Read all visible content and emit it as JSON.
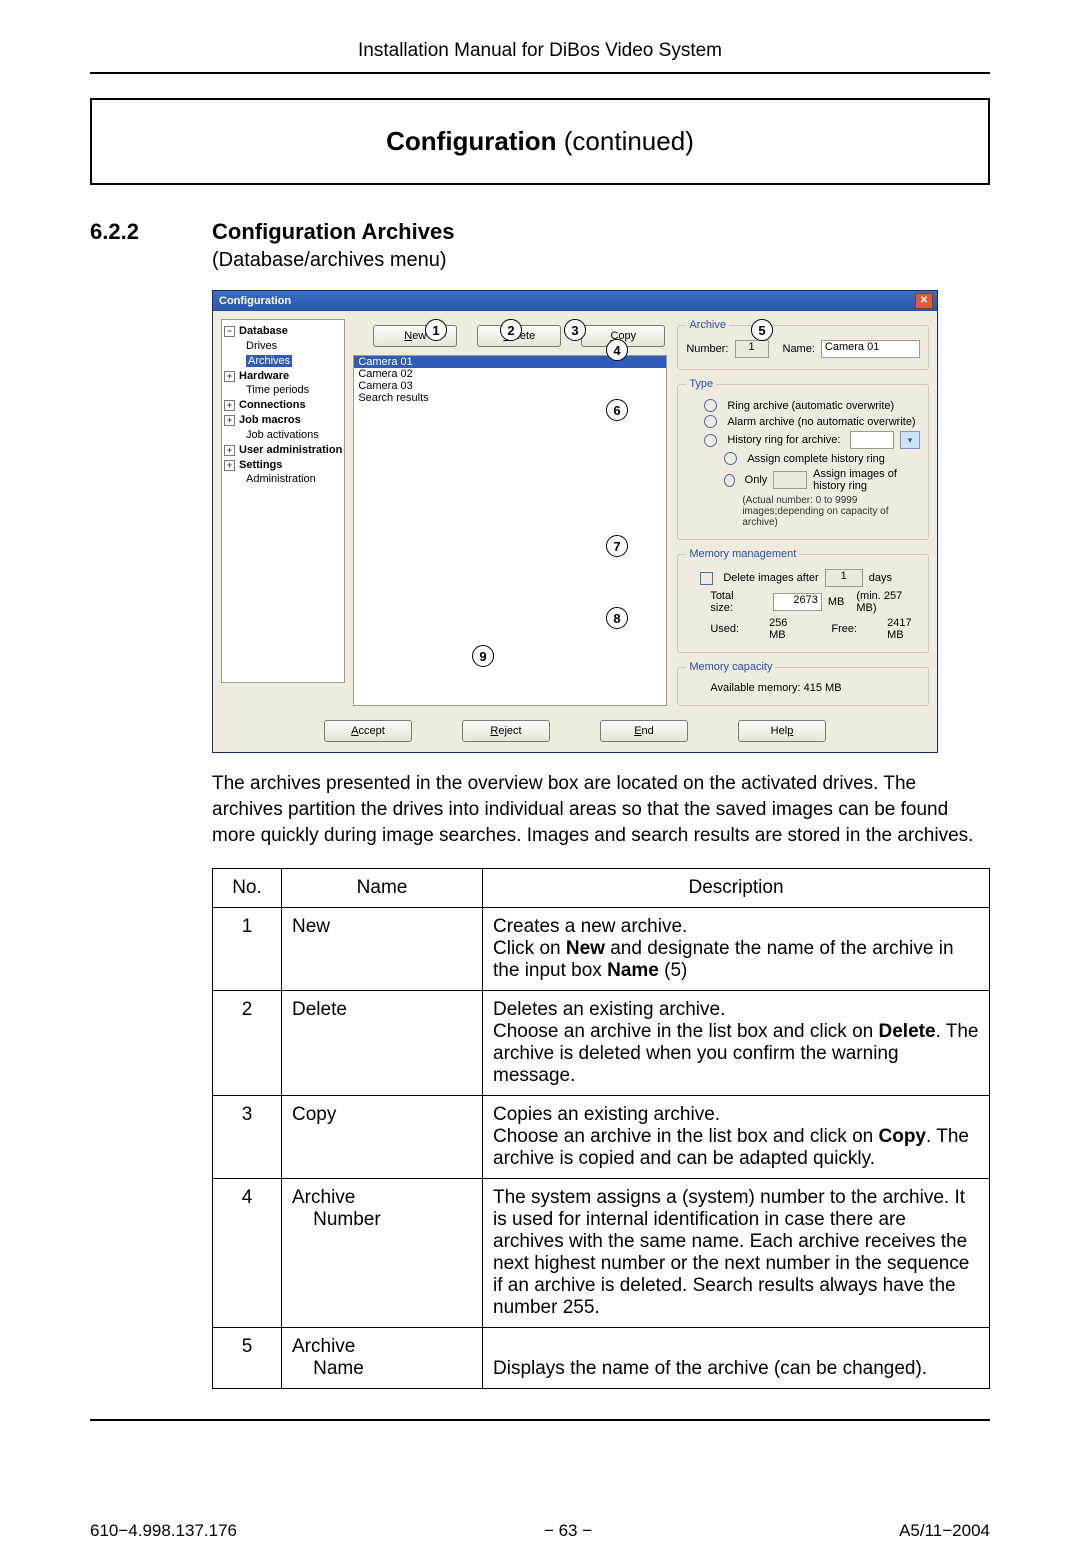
{
  "running_head": "Installation Manual for DiBos Video System",
  "chapter": {
    "title_bold": "Configuration",
    "title_cont": "  (continued)"
  },
  "section": {
    "num": "6.2.2",
    "title": "Configuration Archives",
    "sub": "(Database/archives  menu)"
  },
  "dialog": {
    "title": "Configuration",
    "tree": [
      {
        "t": "Database",
        "lvl": 1,
        "exp": "-"
      },
      {
        "t": "Drives",
        "lvl": 2,
        "sel": false
      },
      {
        "t": "Archives",
        "lvl": 2,
        "sel": true
      },
      {
        "t": "Hardware",
        "lvl": 1,
        "exp": "+"
      },
      {
        "t": "Time periods",
        "lvl": 2,
        "plain": true
      },
      {
        "t": "Connections",
        "lvl": 1,
        "exp": "+"
      },
      {
        "t": "Job macros",
        "lvl": 1,
        "exp": "+"
      },
      {
        "t": "Job activations",
        "lvl": 2,
        "plain": true
      },
      {
        "t": "User administration",
        "lvl": 1,
        "exp": "+"
      },
      {
        "t": "Settings",
        "lvl": 1,
        "exp": "+"
      },
      {
        "t": "Administration",
        "lvl": 2,
        "plain": true
      }
    ],
    "buttons": {
      "new": "New",
      "delete": "Delete",
      "copy": "Copy"
    },
    "list": [
      "Camera 01",
      "Camera 02",
      "Camera 03",
      "Search results"
    ],
    "archive": {
      "legend": "Archive",
      "number_label": "Number:",
      "number_value": "1",
      "name_label": "Name:",
      "name_value": "Camera 01"
    },
    "type": {
      "legend": "Type",
      "ring": "Ring archive    (automatic overwrite)",
      "alarm": "Alarm archive (no automatic overwrite)",
      "history": "History ring for archive:",
      "assign": "Assign complete history ring",
      "only": "Only",
      "only2": "Assign images of history ring",
      "actual": "(Actual number: 0 to 9999 images;depending on capacity of archive)"
    },
    "mem": {
      "legend": "Memory management",
      "del": "Delete images after",
      "days": "days",
      "del_val": "1",
      "total": "Total size:",
      "total_val": "2673",
      "mb": "MB",
      "min": "(min. 257  MB)",
      "used": "Used:",
      "used_val": "256  MB",
      "free": "Free:",
      "free_val": "2417 MB"
    },
    "cap": {
      "legend": "Memory capacity",
      "avail": "Available memory:  415 MB"
    },
    "footer": {
      "accept": "Accept",
      "reject": "Reject",
      "end": "End",
      "help": "Help"
    }
  },
  "callouts": [
    "1",
    "2",
    "3",
    "4",
    "5",
    "6",
    "7",
    "8",
    "9"
  ],
  "body_para": "The archives presented in the overview box are located on the activated drives. The archives partition the drives into individual areas so that the saved images can be found more quickly during image searches. Images and search results are stored in the archives.",
  "table": {
    "head": {
      "no": "No.",
      "name": "Name",
      "desc": "Description"
    },
    "rows": [
      {
        "no": "1",
        "name": "New",
        "desc": "Creates a new archive.\nClick on <b>New</b> and designate the name of the archive in the input box <b>Name</b> (5)"
      },
      {
        "no": "2",
        "name": "Delete",
        "desc": "Deletes an existing archive.\nChoose an archive in the list box and click on <b>Delete</b>. The archive is deleted when you confirm the warning message."
      },
      {
        "no": "3",
        "name": "Copy",
        "desc": "Copies an existing archive.\nChoose an archive in the list box and click on <b>Copy</b>. The archive is copied and can be adapted quickly."
      },
      {
        "no": "4",
        "name": "Archive\n    Number",
        "desc": "The system assigns a (system) number to the archive. It is used for internal identification in case there are archives with the same name. Each archive receives the next highest number or the next number in the sequence if an archive is deleted. Search results always have the number 255."
      },
      {
        "no": "5",
        "name": "Archive\n    Name",
        "desc": "\nDisplays the name of the archive (can be changed)."
      }
    ]
  },
  "footer": {
    "left": "610−4.998.137.176",
    "center": "− 63  −",
    "right": "A5/11−2004"
  }
}
